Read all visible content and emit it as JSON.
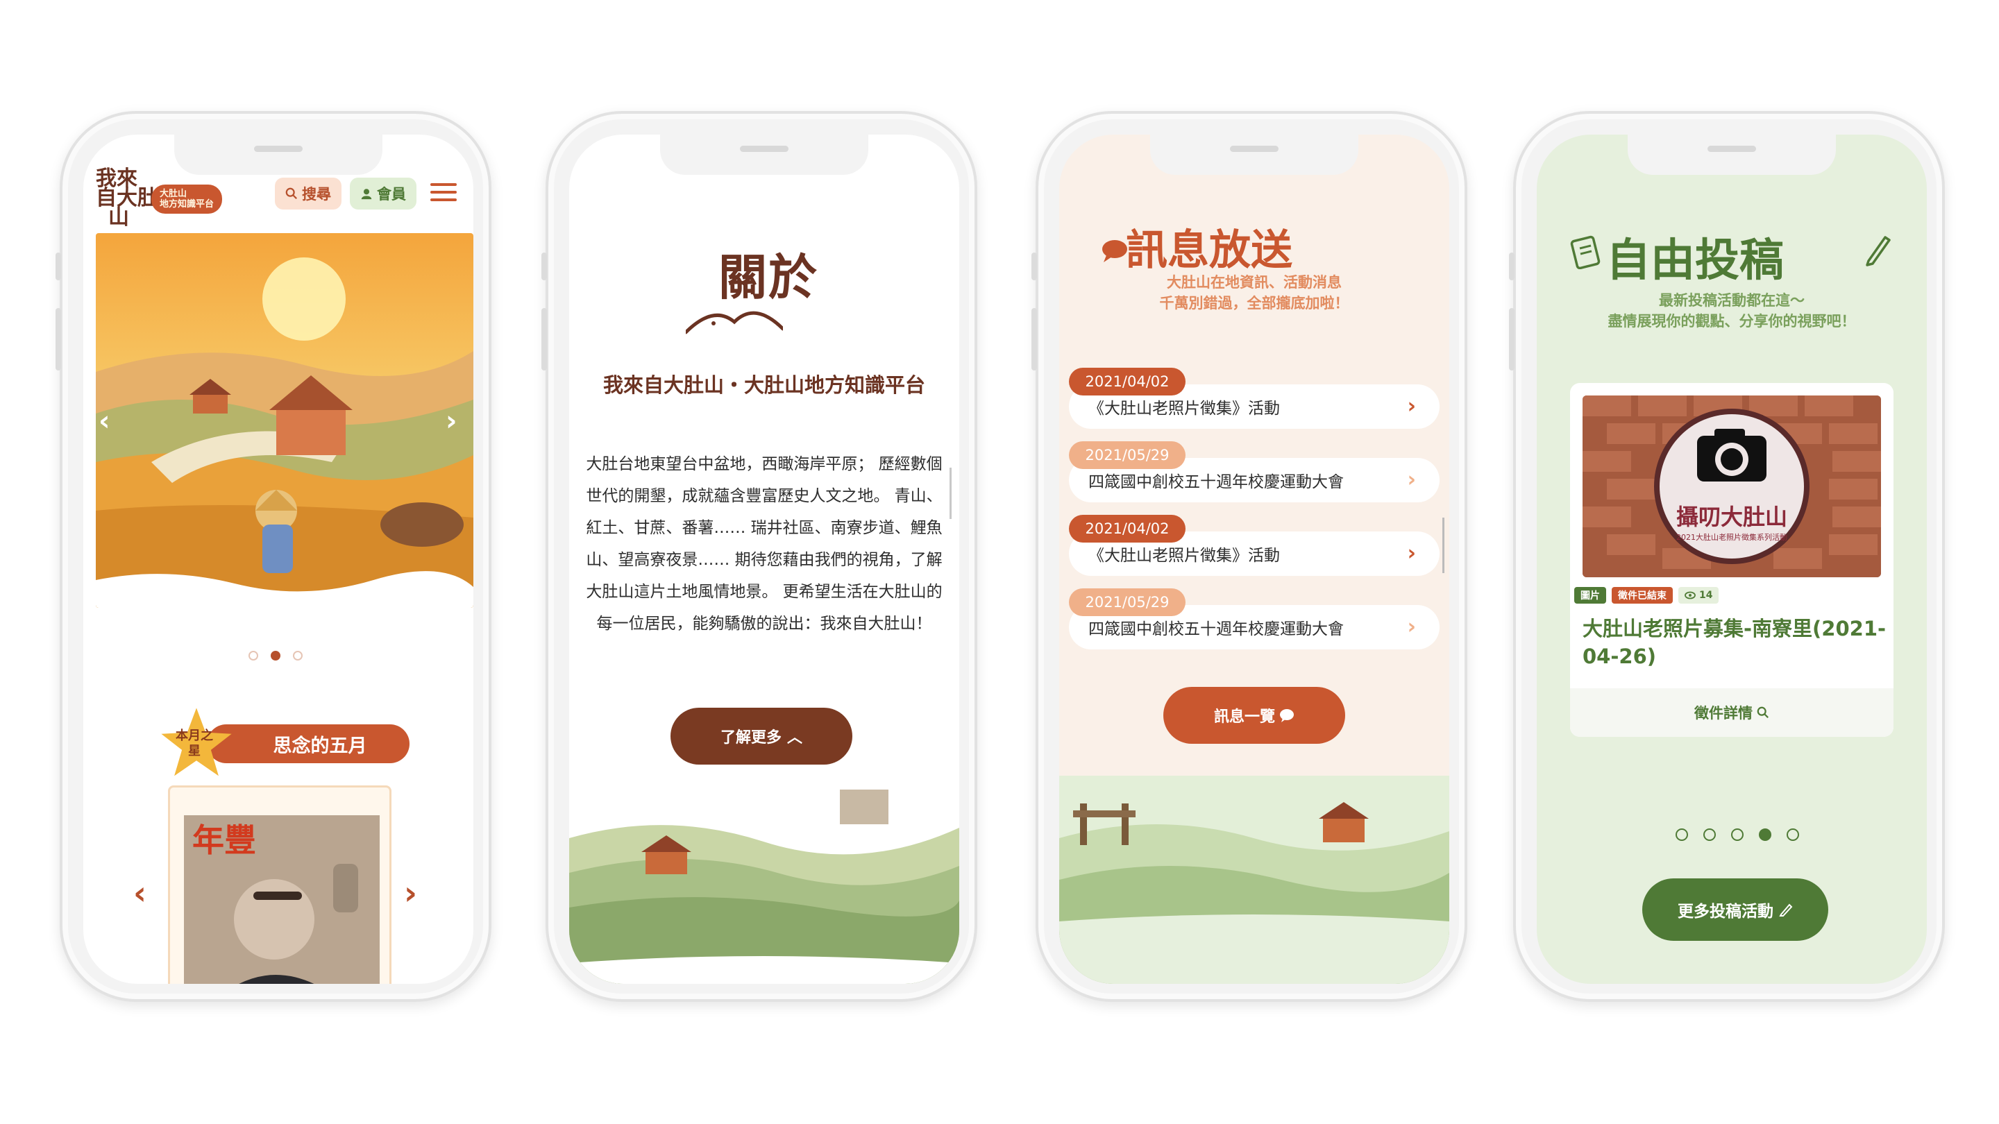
{
  "phone1": {
    "logo": {
      "line1": "我來",
      "line2": "自大肚",
      "line3": "山",
      "badge_line1": "大肚山",
      "badge_line2": "地方知識平台"
    },
    "header": {
      "search_label": "搜尋",
      "member_label": "會員"
    },
    "hero": {
      "active_slide": 2,
      "total_slides": 3
    },
    "star": {
      "badge": "本月之星",
      "title": "思念的五月"
    },
    "cover": {
      "title": "年豐"
    }
  },
  "phone2": {
    "title": "關於",
    "heading": "我來自大肚山・大肚山地方知識平台",
    "body": "大肚台地東望台中盆地，西瞰海岸平原； 歷經數個世代的開墾，成就蘊含豐富歷史人文之地。 青山、紅土、甘蔗、番薯…… 瑞井社區、南寮步道、鯉魚山、望高寮夜景…… 期待您藉由我們的視角，了解大肚山這片土地風情地景。 更希望生活在大肚山的每一位居民，能夠驕傲的說出：我來自大肚山！",
    "button": "了解更多"
  },
  "phone3": {
    "title": "訊息放送",
    "subtitle_line1": "大肚山在地資訊、活動消息",
    "subtitle_line2": "千萬別錯過，全部攏底加啦！",
    "items": [
      {
        "date": "2021/04/02",
        "text": "《大肚山老照片徵集》活動"
      },
      {
        "date": "2021/05/29",
        "text": "四箴國中創校五十週年校慶運動大會"
      },
      {
        "date": "2021/04/02",
        "text": "《大肚山老照片徵集》活動"
      },
      {
        "date": "2021/05/29",
        "text": "四箴國中創校五十週年校慶運動大會"
      }
    ],
    "button": "訊息一覽"
  },
  "phone4": {
    "title": "自由投稿",
    "subtitle_line1": "最新投稿活動都在這～",
    "subtitle_line2": "盡情展現你的觀點、分享你的視野吧！",
    "card": {
      "image_text": "攝叨大肚山",
      "image_small": "2021大肚山老照片徵集系列活動",
      "tag_type": "圖片",
      "tag_status": "徵件已結束",
      "views": "14",
      "title": "大肚山老照片募集-南寮里(2021-04-26)",
      "footer": "徵件詳情"
    },
    "pager": {
      "active": 4,
      "total": 5
    },
    "button": "更多投稿活動"
  },
  "colors": {
    "brown": "#6b3322",
    "orange": "#c9572f",
    "green": "#4f7a36",
    "peach": "#f0b089"
  }
}
